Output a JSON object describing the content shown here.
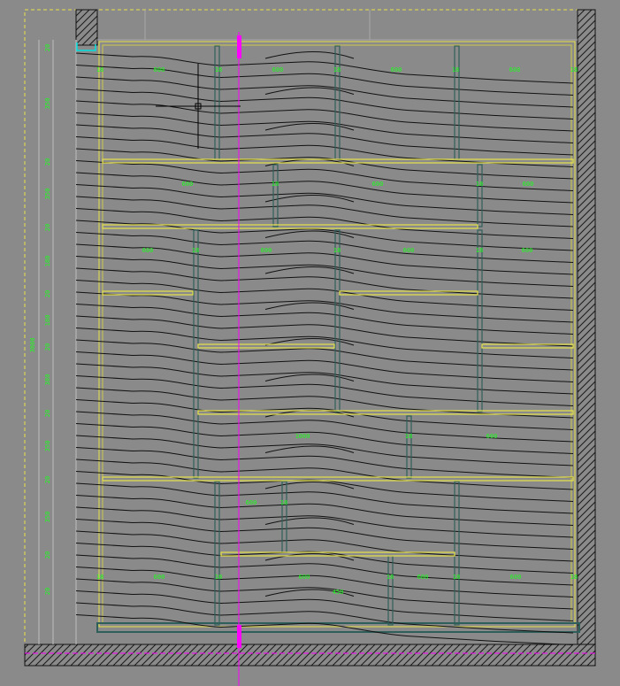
{
  "drawing": {
    "background_color": "#8a8a8a",
    "line_color": "#111111",
    "shelf_color": "#e8e34a",
    "divider_color": "#2f5f5a",
    "dimension_color": "#19ff19",
    "guide_color": "#ff00ff",
    "cursor": "crosshair-cursor-icon"
  },
  "dimensions": {
    "left_column": [
      "20",
      "350",
      "20",
      "350",
      "20",
      "180",
      "20",
      "180",
      "20",
      "380",
      "20",
      "350",
      "20",
      "350",
      "20",
      "20"
    ],
    "left_total": "3000",
    "row1": [
      "18",
      "600",
      "18",
      "600",
      "18",
      "600",
      "18",
      "600",
      "18"
    ],
    "row2": [
      "600",
      "18",
      "600",
      "18",
      "600"
    ],
    "row3": [
      "600",
      "18",
      "600",
      "18",
      "600",
      "18",
      "600"
    ],
    "row4": [
      "1000",
      "18",
      "600"
    ],
    "row5": [
      "600",
      "18"
    ],
    "row6": [
      "18",
      "600",
      "18",
      "600",
      "18",
      "600",
      "18",
      "600",
      "18"
    ],
    "row6_sub": "450"
  }
}
